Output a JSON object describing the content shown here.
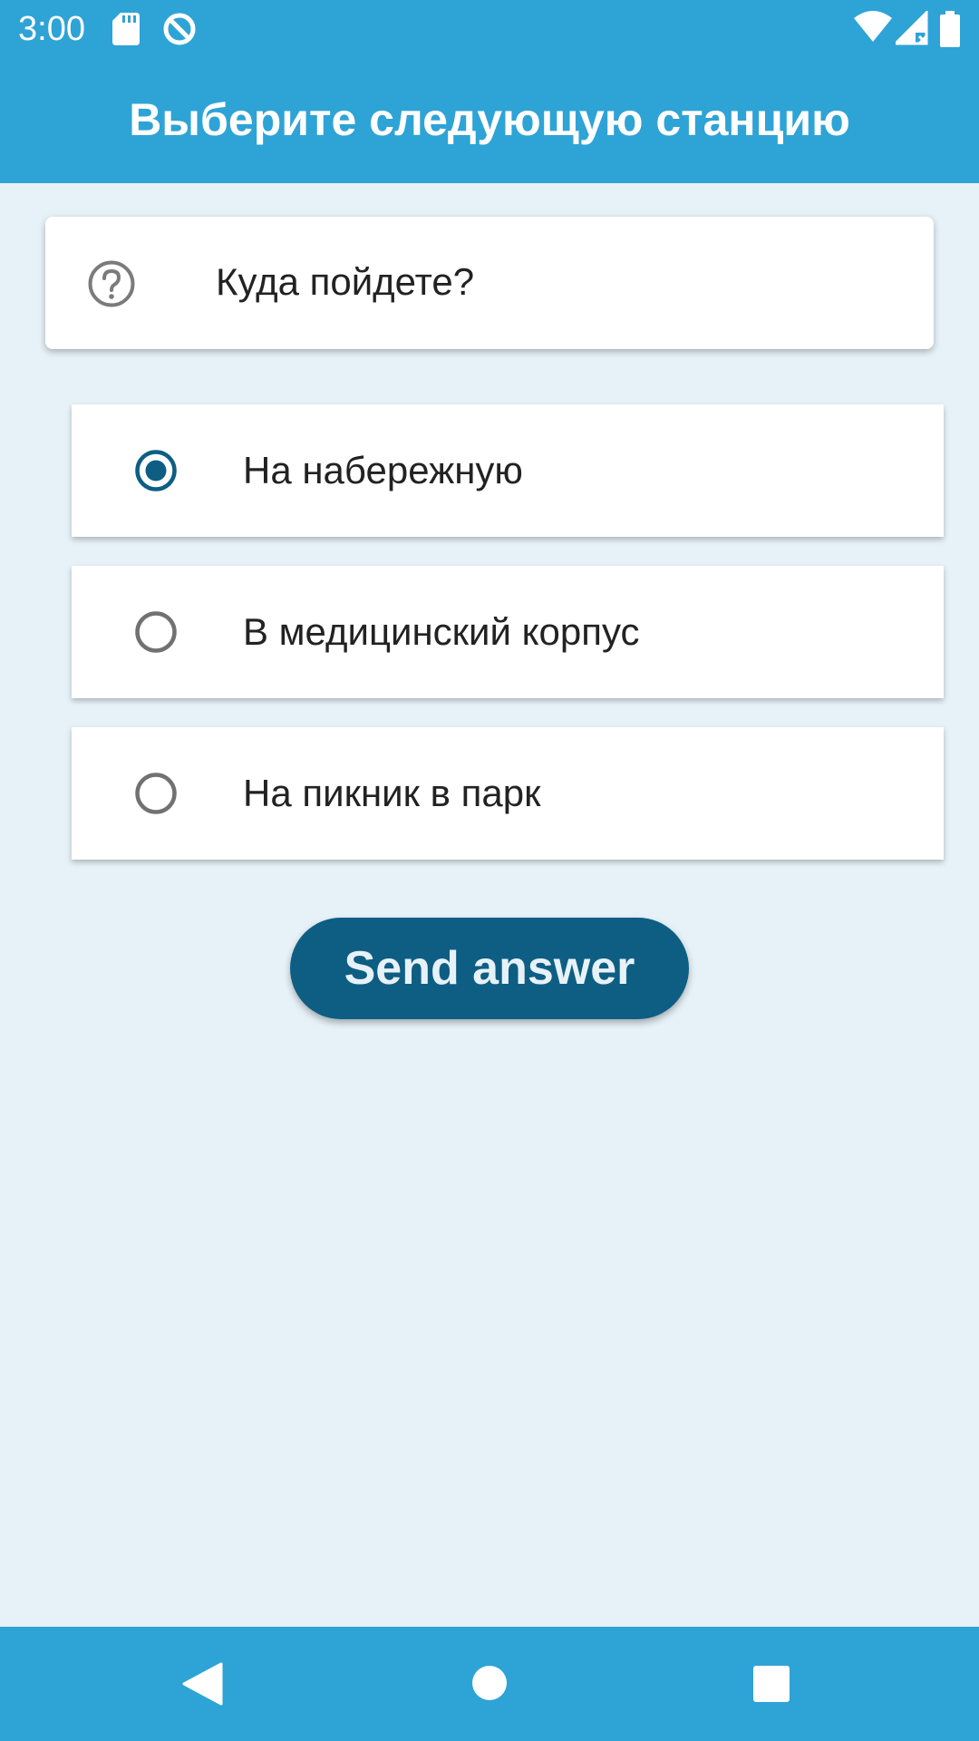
{
  "status_bar": {
    "time": "3:00",
    "icons": [
      "sd-card-icon",
      "data-saver-icon",
      "wifi-icon",
      "cell-signal-icon",
      "battery-icon"
    ]
  },
  "app_bar": {
    "title": "Выберите следующую станцию"
  },
  "question": {
    "icon": "help-circle-icon",
    "text": "Куда пойдете?"
  },
  "options": [
    {
      "label": "На набережную",
      "selected": true
    },
    {
      "label": "В медицинский корпус",
      "selected": false
    },
    {
      "label": "На пикник в парк",
      "selected": false
    }
  ],
  "send_button": {
    "label": "Send answer"
  },
  "nav_bar": {
    "buttons": [
      "back-icon",
      "home-icon",
      "recents-icon"
    ]
  },
  "colors": {
    "primary": "#2ea3d6",
    "accent": "#0e5e84",
    "background": "#e7f2f8"
  }
}
